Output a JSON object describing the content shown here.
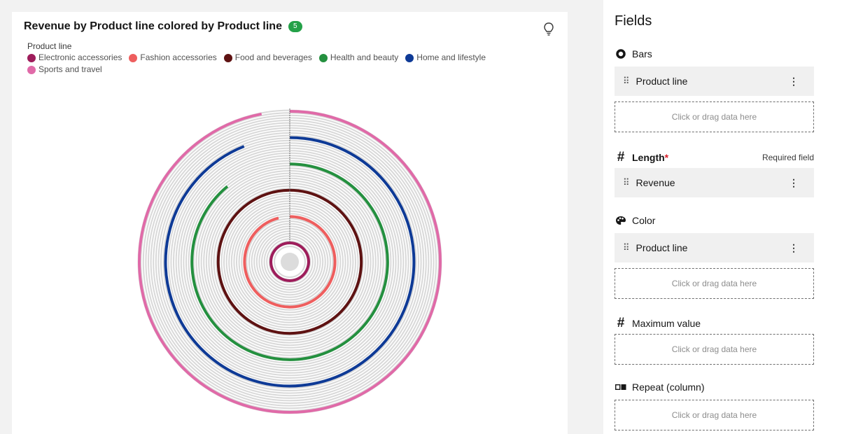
{
  "card": {
    "title": "Revenue by Product line colored by Product line",
    "badge_count": "5",
    "legend_title": "Product line",
    "legend": [
      {
        "label": "Electronic accessories",
        "color": "#9e1d5b"
      },
      {
        "label": "Fashion accessories",
        "color": "#ee5e5e"
      },
      {
        "label": "Food and beverages",
        "color": "#5e1212"
      },
      {
        "label": "Health and beauty",
        "color": "#24903f"
      },
      {
        "label": "Home and lifestyle",
        "color": "#0e3a96"
      },
      {
        "label": "Sports and travel",
        "color": "#e06aa8"
      }
    ]
  },
  "chart_data": {
    "type": "radial-bar",
    "categories": [
      "Electronic accessories",
      "Fashion accessories",
      "Food and beverages",
      "Health and beauty",
      "Home and lifestyle",
      "Sports and travel"
    ],
    "values": [
      100,
      96,
      100,
      89,
      94,
      97
    ],
    "value_unit": "percent of full circle",
    "colors": [
      "#9e1d5b",
      "#ee5e5e",
      "#5e1212",
      "#24903f",
      "#0e3a96",
      "#e06aa8"
    ]
  },
  "panel": {
    "title": "Fields",
    "sections": {
      "bars": {
        "label": "Bars",
        "item": "Product line"
      },
      "length": {
        "label": "Length",
        "required_mark": "*",
        "required_note": "Required field",
        "item": "Revenue"
      },
      "color": {
        "label": "Color",
        "item": "Product line"
      },
      "maximum": {
        "label": "Maximum value"
      },
      "repeat": {
        "label": "Repeat (column)"
      }
    },
    "drop_placeholder": "Click or drag data here",
    "drag_glyph": "⠿",
    "kebab_glyph": "⋮"
  },
  "icons": {
    "bars": "donut-icon",
    "length": "hash-icon",
    "color": "palette-icon",
    "maximum": "hash-icon",
    "repeat": "repeat-column-icon",
    "insight": "lightbulb-icon"
  }
}
